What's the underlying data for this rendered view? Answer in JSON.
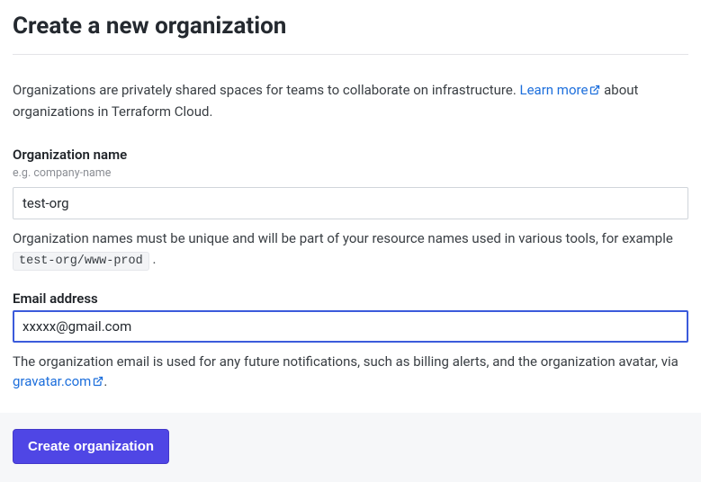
{
  "header": {
    "title": "Create a new organization"
  },
  "intro": {
    "text_before": "Organizations are privately shared spaces for teams to collaborate on infrastructure. ",
    "learn_more_label": "Learn more",
    "text_after": " about organizations in Terraform Cloud."
  },
  "org_name": {
    "label": "Organization name",
    "hint": "e.g. company-name",
    "value": "test-org",
    "help_prefix": "Organization names must be unique and will be part of your resource names used in various tools, for example ",
    "help_code": "test-org/www-prod",
    "help_suffix": " ."
  },
  "email": {
    "label": "Email address",
    "value": "xxxxx@gmail.com",
    "help_before": "The organization email is used for any future notifications, such as billing alerts, and the organization avatar, via ",
    "gravatar_label": "gravatar.com",
    "help_after": "."
  },
  "submit": {
    "label": "Create organization"
  }
}
